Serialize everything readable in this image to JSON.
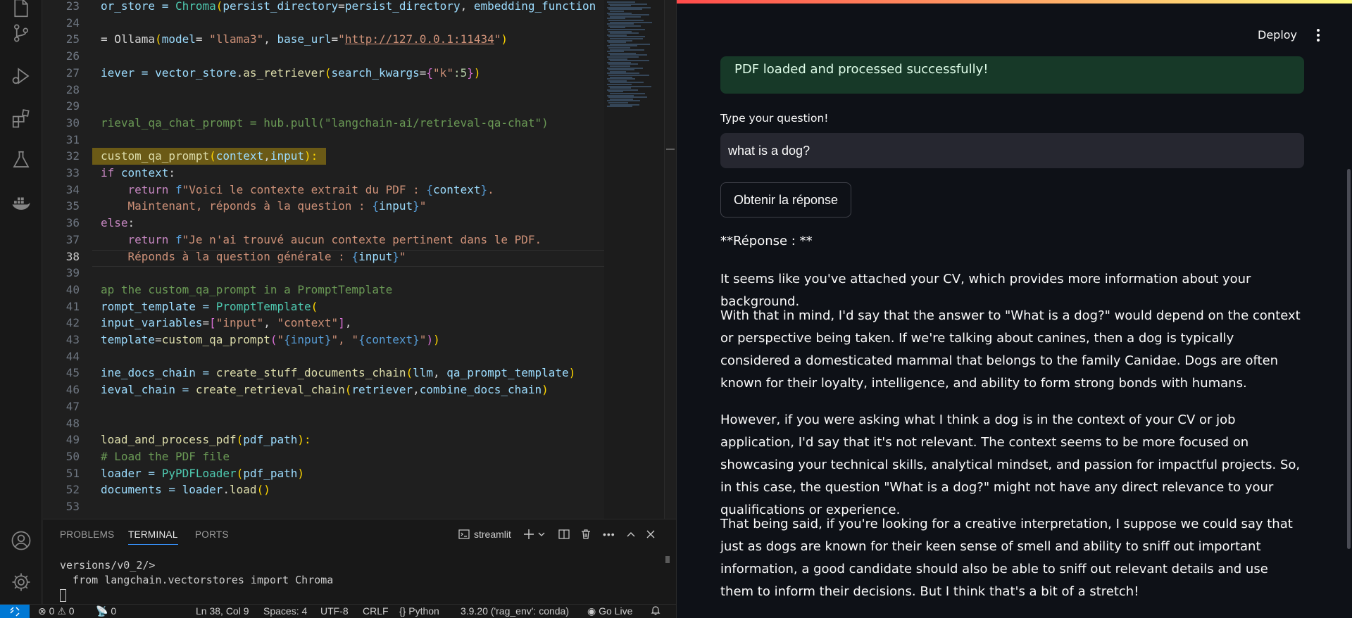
{
  "editor": {
    "lines": [
      {
        "num": "23",
        "segments": [
          {
            "t": "or_store = ",
            "c": "#9cdcfe"
          },
          {
            "t": "Chroma",
            "c": "#4ec9b0"
          },
          {
            "t": "(",
            "c": "#ffd700"
          },
          {
            "t": "persist_directory",
            "c": "#9cdcfe"
          },
          {
            "t": "=",
            "c": "#d4d4d4"
          },
          {
            "t": "persist_directory",
            "c": "#9cdcfe"
          },
          {
            "t": ", ",
            "c": "#d4d4d4"
          },
          {
            "t": "embedding_function",
            "c": "#9cdcfe"
          }
        ]
      },
      {
        "num": "24",
        "segments": []
      },
      {
        "num": "25",
        "segments": [
          {
            "t": "= ",
            "c": "#d4d4d4"
          },
          {
            "t": "Ollama",
            "c": "#d4d4d4"
          },
          {
            "t": "(",
            "c": "#ffd700"
          },
          {
            "t": "model",
            "c": "#9cdcfe"
          },
          {
            "t": "= ",
            "c": "#d4d4d4"
          },
          {
            "t": "\"llama3\"",
            "c": "#ce9178"
          },
          {
            "t": ", ",
            "c": "#d4d4d4"
          },
          {
            "t": "base_url",
            "c": "#9cdcfe"
          },
          {
            "t": "=",
            "c": "#d4d4d4"
          },
          {
            "t": "\"",
            "c": "#ce9178"
          },
          {
            "t": "http://127.0.0.1:11434",
            "c": "#ce9178",
            "u": true
          },
          {
            "t": "\"",
            "c": "#ce9178"
          },
          {
            "t": ")",
            "c": "#ffd700"
          }
        ]
      },
      {
        "num": "26",
        "segments": []
      },
      {
        "num": "27",
        "segments": [
          {
            "t": "iever = ",
            "c": "#9cdcfe"
          },
          {
            "t": "vector_store",
            "c": "#9cdcfe"
          },
          {
            "t": ".",
            "c": "#d4d4d4"
          },
          {
            "t": "as_retriever",
            "c": "#dcdcaa"
          },
          {
            "t": "(",
            "c": "#ffd700"
          },
          {
            "t": "search_kwargs",
            "c": "#9cdcfe"
          },
          {
            "t": "=",
            "c": "#d4d4d4"
          },
          {
            "t": "{",
            "c": "#da70d6"
          },
          {
            "t": "\"k\"",
            "c": "#ce9178"
          },
          {
            "t": ":5",
            "c": "#b5cea8"
          },
          {
            "t": "}",
            "c": "#da70d6"
          },
          {
            "t": ")",
            "c": "#ffd700"
          }
        ]
      },
      {
        "num": "28",
        "segments": []
      },
      {
        "num": "29",
        "segments": []
      },
      {
        "num": "30",
        "segments": [
          {
            "t": "rieval_qa_chat_prompt = hub.pull(\"langchain-ai/retrieval-qa-chat\")",
            "c": "#6a9955"
          }
        ]
      },
      {
        "num": "31",
        "segments": []
      },
      {
        "num": "32",
        "hl": true,
        "segments": [
          {
            "t": "custom_qa_prompt",
            "c": "#dcdcaa"
          },
          {
            "t": "(",
            "c": "#ffd700"
          },
          {
            "t": "context",
            "c": "#9cdcfe"
          },
          {
            "t": ",",
            "c": "#d4d4d4"
          },
          {
            "t": "input",
            "c": "#9cdcfe"
          },
          {
            "t": "):",
            "c": "#ffd700"
          }
        ]
      },
      {
        "num": "33",
        "segments": [
          {
            "t": "if ",
            "c": "#c586c0"
          },
          {
            "t": "context",
            "c": "#9cdcfe"
          },
          {
            "t": ":",
            "c": "#d4d4d4"
          }
        ]
      },
      {
        "num": "34",
        "segments": [
          {
            "t": "    return ",
            "c": "#c586c0"
          },
          {
            "t": "f",
            "c": "#569cd6"
          },
          {
            "t": "\"Voici le contexte extrait du PDF : ",
            "c": "#ce9178"
          },
          {
            "t": "{",
            "c": "#569cd6"
          },
          {
            "t": "context",
            "c": "#9cdcfe"
          },
          {
            "t": "}",
            "c": "#569cd6"
          },
          {
            "t": ".",
            "c": "#ce9178"
          }
        ]
      },
      {
        "num": "35",
        "segments": [
          {
            "t": "    Maintenant, réponds à la question : ",
            "c": "#ce9178"
          },
          {
            "t": "{",
            "c": "#569cd6"
          },
          {
            "t": "input",
            "c": "#9cdcfe"
          },
          {
            "t": "}",
            "c": "#569cd6"
          },
          {
            "t": "\"",
            "c": "#ce9178"
          }
        ]
      },
      {
        "num": "36",
        "segments": [
          {
            "t": "else",
            "c": "#c586c0"
          },
          {
            "t": ":",
            "c": "#d4d4d4"
          }
        ]
      },
      {
        "num": "37",
        "segments": [
          {
            "t": "    return ",
            "c": "#c586c0"
          },
          {
            "t": "f",
            "c": "#569cd6"
          },
          {
            "t": "\"Je n'ai trouvé aucun contexte pertinent dans le PDF.",
            "c": "#ce9178"
          }
        ]
      },
      {
        "num": "38",
        "active": true,
        "segments": [
          {
            "t": "    Réponds à la question générale : ",
            "c": "#ce9178"
          },
          {
            "t": "{",
            "c": "#569cd6"
          },
          {
            "t": "input",
            "c": "#9cdcfe"
          },
          {
            "t": "}",
            "c": "#569cd6"
          },
          {
            "t": "\"",
            "c": "#ce9178"
          }
        ]
      },
      {
        "num": "39",
        "segments": []
      },
      {
        "num": "40",
        "segments": [
          {
            "t": "ap the custom_qa_prompt in a PromptTemplate",
            "c": "#6a9955"
          }
        ]
      },
      {
        "num": "41",
        "segments": [
          {
            "t": "rompt_template = ",
            "c": "#9cdcfe"
          },
          {
            "t": "PromptTemplate",
            "c": "#4ec9b0"
          },
          {
            "t": "(",
            "c": "#ffd700"
          }
        ]
      },
      {
        "num": "42",
        "segments": [
          {
            "t": "input_variables",
            "c": "#9cdcfe"
          },
          {
            "t": "=",
            "c": "#d4d4d4"
          },
          {
            "t": "[",
            "c": "#da70d6"
          },
          {
            "t": "\"input\"",
            "c": "#ce9178"
          },
          {
            "t": ", ",
            "c": "#d4d4d4"
          },
          {
            "t": "\"context\"",
            "c": "#ce9178"
          },
          {
            "t": "]",
            "c": "#da70d6"
          },
          {
            "t": ",",
            "c": "#d4d4d4"
          }
        ]
      },
      {
        "num": "43",
        "segments": [
          {
            "t": "template",
            "c": "#9cdcfe"
          },
          {
            "t": "=",
            "c": "#d4d4d4"
          },
          {
            "t": "custom_qa_prompt",
            "c": "#dcdcaa"
          },
          {
            "t": "(",
            "c": "#da70d6"
          },
          {
            "t": "\"",
            "c": "#ce9178"
          },
          {
            "t": "{input}",
            "c": "#569cd6"
          },
          {
            "t": "\", ",
            "c": "#ce9178"
          },
          {
            "t": "\"",
            "c": "#ce9178"
          },
          {
            "t": "{context}",
            "c": "#569cd6"
          },
          {
            "t": "\"",
            "c": "#ce9178"
          },
          {
            "t": ")",
            "c": "#da70d6"
          },
          {
            "t": ")",
            "c": "#ffd700"
          }
        ]
      },
      {
        "num": "44",
        "segments": []
      },
      {
        "num": "45",
        "segments": [
          {
            "t": "ine_docs_chain = ",
            "c": "#9cdcfe"
          },
          {
            "t": "create_stuff_documents_chain",
            "c": "#dcdcaa"
          },
          {
            "t": "(",
            "c": "#ffd700"
          },
          {
            "t": "llm",
            "c": "#9cdcfe"
          },
          {
            "t": ", ",
            "c": "#d4d4d4"
          },
          {
            "t": "qa_prompt_template",
            "c": "#9cdcfe"
          },
          {
            "t": ")",
            "c": "#ffd700"
          }
        ]
      },
      {
        "num": "46",
        "segments": [
          {
            "t": "ieval_chain = ",
            "c": "#9cdcfe"
          },
          {
            "t": "create_retrieval_chain",
            "c": "#dcdcaa"
          },
          {
            "t": "(",
            "c": "#ffd700"
          },
          {
            "t": "retriever",
            "c": "#9cdcfe"
          },
          {
            "t": ",",
            "c": "#d4d4d4"
          },
          {
            "t": "combine_docs_chain",
            "c": "#9cdcfe"
          },
          {
            "t": ")",
            "c": "#ffd700"
          }
        ]
      },
      {
        "num": "47",
        "segments": []
      },
      {
        "num": "48",
        "segments": []
      },
      {
        "num": "49",
        "segments": [
          {
            "t": "load_and_process_pdf",
            "c": "#dcdcaa"
          },
          {
            "t": "(",
            "c": "#ffd700"
          },
          {
            "t": "pdf_path",
            "c": "#9cdcfe"
          },
          {
            "t": "):",
            "c": "#ffd700"
          }
        ]
      },
      {
        "num": "50",
        "segments": [
          {
            "t": "# Load the PDF file",
            "c": "#6a9955"
          }
        ]
      },
      {
        "num": "51",
        "segments": [
          {
            "t": "loader = ",
            "c": "#9cdcfe"
          },
          {
            "t": "PyPDFLoader",
            "c": "#4ec9b0"
          },
          {
            "t": "(",
            "c": "#ffd700"
          },
          {
            "t": "pdf_path",
            "c": "#9cdcfe"
          },
          {
            "t": ")",
            "c": "#ffd700"
          }
        ]
      },
      {
        "num": "52",
        "segments": [
          {
            "t": "documents = ",
            "c": "#9cdcfe"
          },
          {
            "t": "loader",
            "c": "#9cdcfe"
          },
          {
            "t": ".",
            "c": "#d4d4d4"
          },
          {
            "t": "load",
            "c": "#dcdcaa"
          },
          {
            "t": "()",
            "c": "#ffd700"
          }
        ]
      },
      {
        "num": "53",
        "segments": []
      }
    ]
  },
  "panel": {
    "tabs": [
      "PROBLEMS",
      "TERMINAL",
      "PORTS"
    ],
    "active_tab": "TERMINAL",
    "terminal_name": "streamlit",
    "terminal_lines": [
      "versions/v0_2/>",
      "  from langchain.vectorstores import Chroma"
    ]
  },
  "status_bar": {
    "errors": "0",
    "warnings": "0",
    "ports": "0",
    "cursor": "Ln 38, Col 9",
    "spaces": "Spaces: 4",
    "encoding": "UTF-8",
    "eol": "CRLF",
    "language": "Python",
    "interpreter": "3.9.20 ('rag_env': conda)",
    "go_live": "Go Live"
  },
  "app": {
    "deploy_label": "Deploy",
    "success_message": "PDF loaded and processed successfully!",
    "question_label": "Type your question!",
    "question_value": "what is a dog?",
    "submit_label": "Obtenir la réponse",
    "answer_heading": "**Réponse : **",
    "answer_paragraphs": [
      "It seems like you've attached your CV, which provides more information about your background.",
      "With that in mind, I'd say that the answer to \"What is a dog?\" would depend on the context or perspective being taken. If we're talking about canines, then a dog is typically considered a domesticated mammal that belongs to the family Canidae. Dogs are often known for their loyalty, intelligence, and ability to form strong bonds with humans.",
      "However, if you were asking what I think a dog is in the context of your CV or job application, I'd say that it's not relevant. The context seems to be more focused on showcasing your technical skills, analytical mindset, and passion for impactful projects. So, in this case, the question \"What is a dog?\" might not have any direct relevance to your qualifications or experience.",
      "That being said, if you're looking for a creative interpretation, I suppose we could say that just as dogs are known for their keen sense of smell and ability to sniff out important information, a good candidate should also be able to sniff out relevant details and use them to inform their decisions. But I think that's a bit of a stretch!"
    ]
  },
  "icons": [
    "explorer-icon",
    "source-control-icon",
    "run-debug-icon",
    "extensions-icon",
    "testing-icon",
    "docker-icon",
    "account-icon",
    "settings-gear-icon"
  ]
}
